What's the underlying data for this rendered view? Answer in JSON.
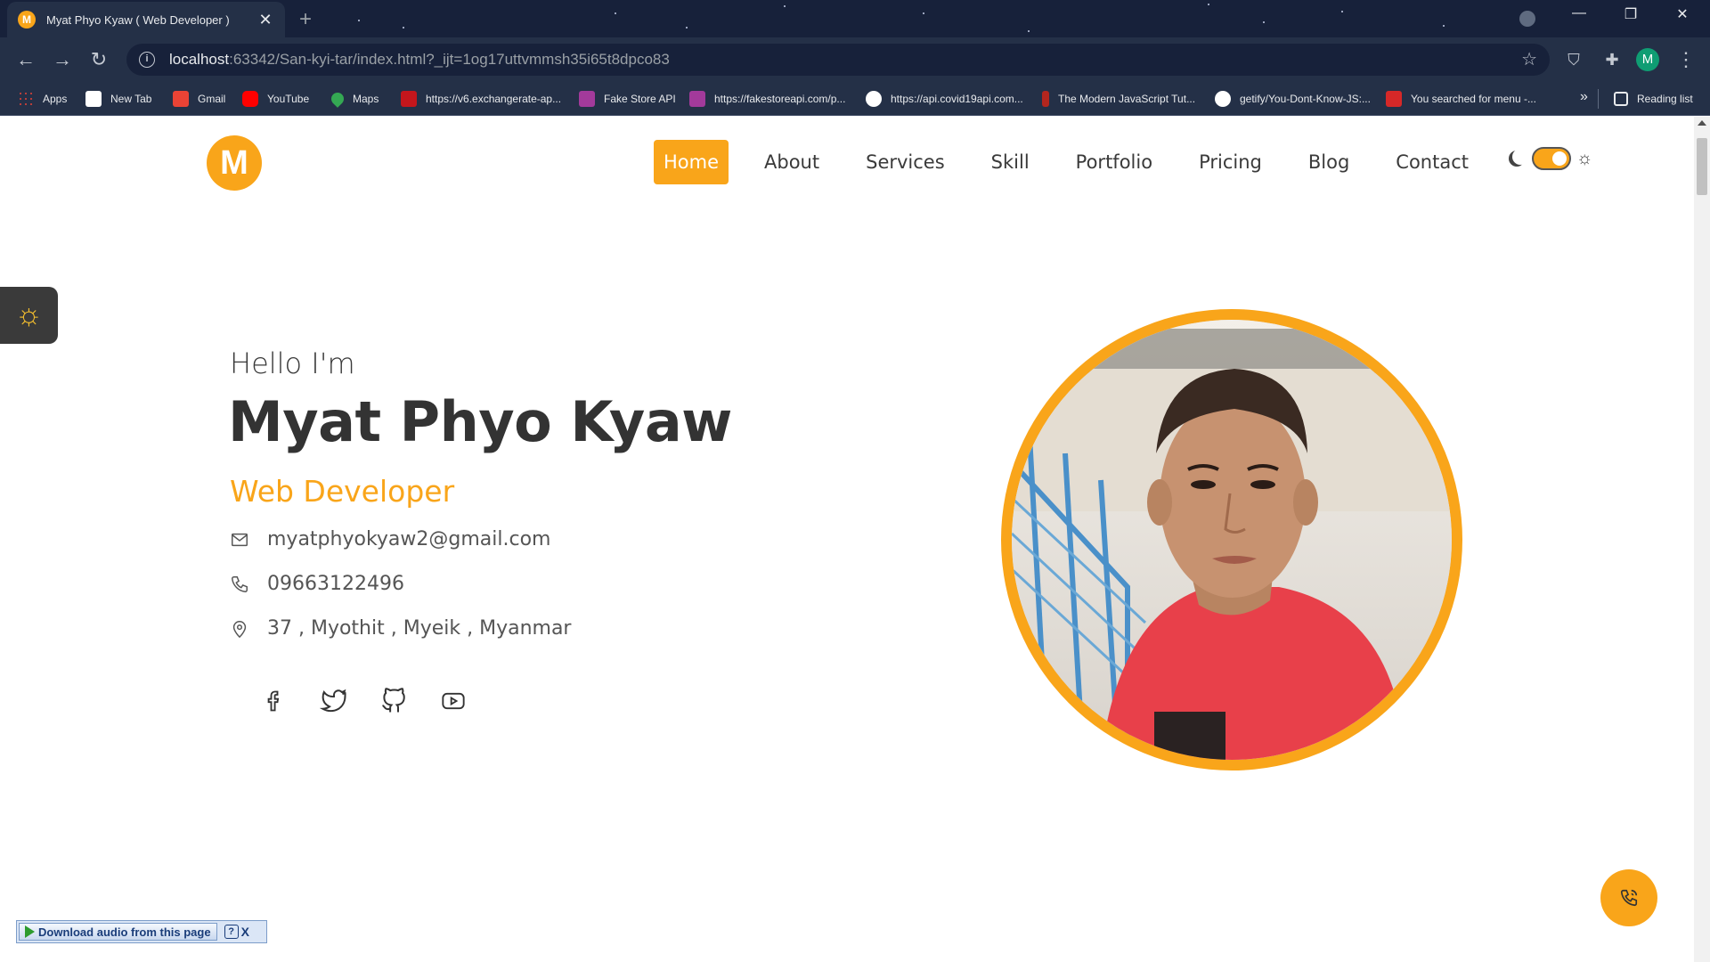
{
  "browser": {
    "tab_title": "Myat Phyo Kyaw ( Web Developer )",
    "tab_favicon_letter": "M",
    "url_host": "localhost",
    "url_rest": ":63342/San-kyi-tar/index.html?_ijt=1og17uttvmmsh35i65t8dpco83",
    "profile_letter": "M",
    "bookmarks": [
      {
        "label": "Apps",
        "color": "#4285f4"
      },
      {
        "label": "New Tab",
        "color": "#ffffff"
      },
      {
        "label": "Gmail",
        "color": "#ea4335"
      },
      {
        "label": "YouTube",
        "color": "#ff0000"
      },
      {
        "label": "Maps",
        "color": "#34a853"
      },
      {
        "label": "https://v6.exchangerate-ap...",
        "color": "#c4161c"
      },
      {
        "label": "Fake Store API",
        "color": "#a33a9b"
      },
      {
        "label": "https://fakestoreapi.com/p...",
        "color": "#a33a9b"
      },
      {
        "label": "https://api.covid19api.com...",
        "color": "#ffffff"
      },
      {
        "label": "The Modern JavaScript Tut...",
        "color": "#b3261e"
      },
      {
        "label": "getify/You-Dont-Know-JS:...",
        "color": "#ffffff"
      },
      {
        "label": "You searched for menu -...",
        "color": "#d62828"
      }
    ],
    "reading_list": "Reading list"
  },
  "site": {
    "logo_letter": "M",
    "nav": [
      "Home",
      "About",
      "Services",
      "Skill",
      "Portfolio",
      "Pricing",
      "Blog",
      "Contact"
    ],
    "active_nav": "Home",
    "theme_dark": false
  },
  "hero": {
    "greeting": "Hello I'm",
    "name": "Myat Phyo Kyaw",
    "role": "Web Developer",
    "email": "myatphyokyaw2@gmail.com",
    "phone": "09663122496",
    "address": "37 , Myothit , Myeik , Myanmar",
    "socials": [
      "facebook-icon",
      "twitter-icon",
      "github-icon",
      "youtube-icon"
    ]
  },
  "extension_bar": {
    "label": "Download audio from this page",
    "help": "?",
    "close": "X"
  },
  "colors": {
    "accent": "#f9a51a",
    "text_dark": "#333333",
    "browser_bg": "#243047"
  }
}
